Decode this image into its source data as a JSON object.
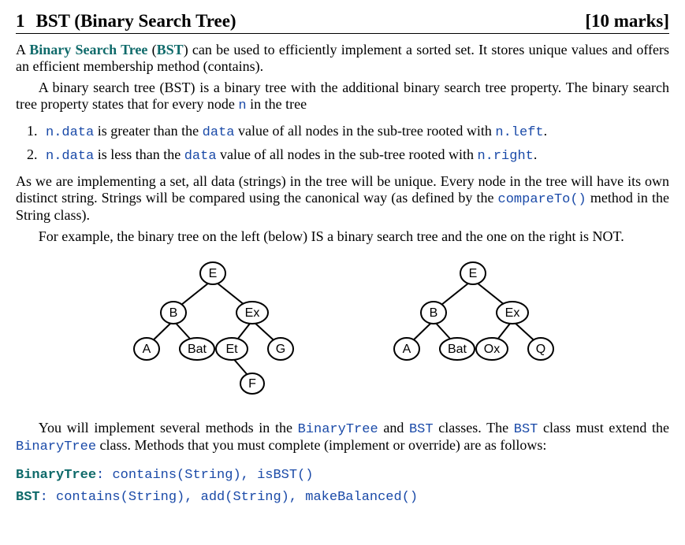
{
  "heading": {
    "number": "1",
    "title_plain": "BST (Binary Search Tree)",
    "marks": "[10 marks]"
  },
  "p1": {
    "a": "A ",
    "term1": "Binary Search Tree",
    "b": " (",
    "term2": "BST",
    "c": ") can be used to efficiently implement a sorted set. It stores unique values and offers an efficient membership method (contains)."
  },
  "p2": {
    "a": "A binary search tree (BST) is a binary tree with the additional binary search tree property. The binary search tree property states that for every node ",
    "code_n": "n",
    "b": " in the tree"
  },
  "item1": {
    "a_code": "n.data",
    "b": " is greater than the ",
    "c_code": "data",
    "d": " value of all nodes in the sub-tree rooted with ",
    "e_code": "n.left",
    "f": "."
  },
  "item2": {
    "a_code": "n.data",
    "b": " is less than the ",
    "c_code": "data",
    "d": " value of all nodes in the sub-tree rooted with ",
    "e_code": "n.right",
    "f": "."
  },
  "p3": {
    "a": "As we are implementing a set, all data (strings) in the tree will be unique. Every node in the tree will have its own distinct string. Strings will be compared using the canonical way (as defined by the ",
    "code": "compareTo()",
    "b": " method in the String class)."
  },
  "p4": "For example, the binary tree on the left (below) IS a binary search tree and the one on the right is NOT.",
  "trees": {
    "left": {
      "nodes": {
        "root": "E",
        "l": "B",
        "r": "Ex",
        "ll": "A",
        "lr": "Bat",
        "rl": "Et",
        "rr": "G",
        "rlr": "F"
      }
    },
    "right": {
      "nodes": {
        "root": "E",
        "l": "B",
        "r": "Ex",
        "ll": "A",
        "lr": "Bat",
        "rl": "Ox",
        "rr": "Q"
      }
    }
  },
  "p5": {
    "a": "You will implement several methods in the ",
    "c1": "BinaryTree",
    "b": " and ",
    "c2": "BST",
    "c": " classes.  The ",
    "c3": "BST",
    "d": " class must extend the ",
    "c4": "BinaryTree",
    "e": " class.  Methods that you must complete (implement or override) are as follows:"
  },
  "sig1": {
    "cls": "BinaryTree",
    "sep": ": ",
    "m1": "contains(String)",
    "comma": ", ",
    "m2": "isBST()"
  },
  "sig2": {
    "cls": "BST",
    "sep": ": ",
    "m1": "contains(String)",
    "c1": ", ",
    "m2": "add(String)",
    "c2": ", ",
    "m3": "makeBalanced()"
  }
}
